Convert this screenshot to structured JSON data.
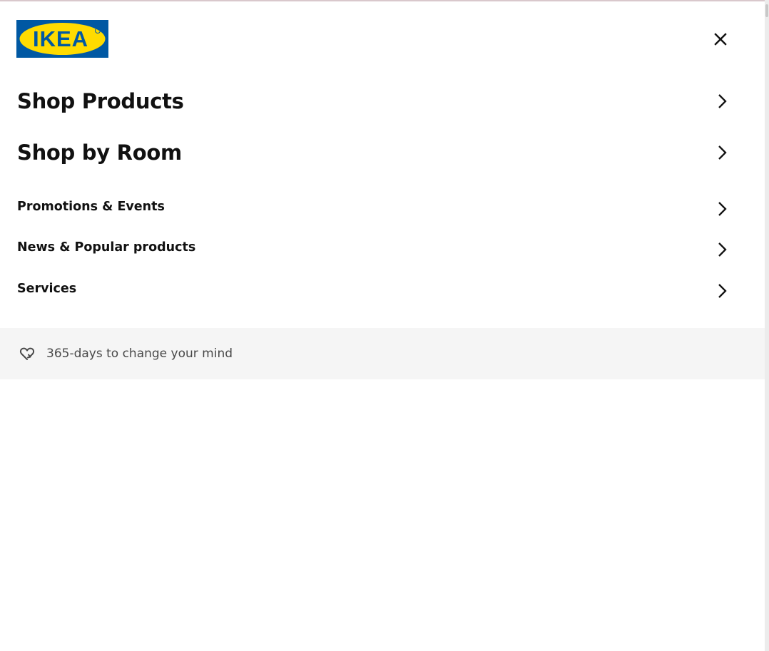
{
  "brand": {
    "logo_text": "IKEA",
    "colors": {
      "blue": "#0058a3",
      "yellow": "#ffdb00",
      "text": "#111111",
      "muted_text": "#484848",
      "promo_background": "#f5f5f5"
    }
  },
  "header": {
    "close_icon": "close-icon"
  },
  "menu": {
    "primary": [
      {
        "label": "Shop Products",
        "icon": "chevron-right-icon"
      },
      {
        "label": "Shop by Room",
        "icon": "chevron-right-icon"
      }
    ],
    "secondary": [
      {
        "label": "Promotions & Events",
        "icon": "chevron-right-icon"
      },
      {
        "label": "News & Popular products",
        "icon": "chevron-right-icon"
      },
      {
        "label": "Services",
        "icon": "chevron-right-icon"
      }
    ]
  },
  "promo": {
    "icon": "heart-return-icon",
    "text": "365-days to change your mind"
  }
}
